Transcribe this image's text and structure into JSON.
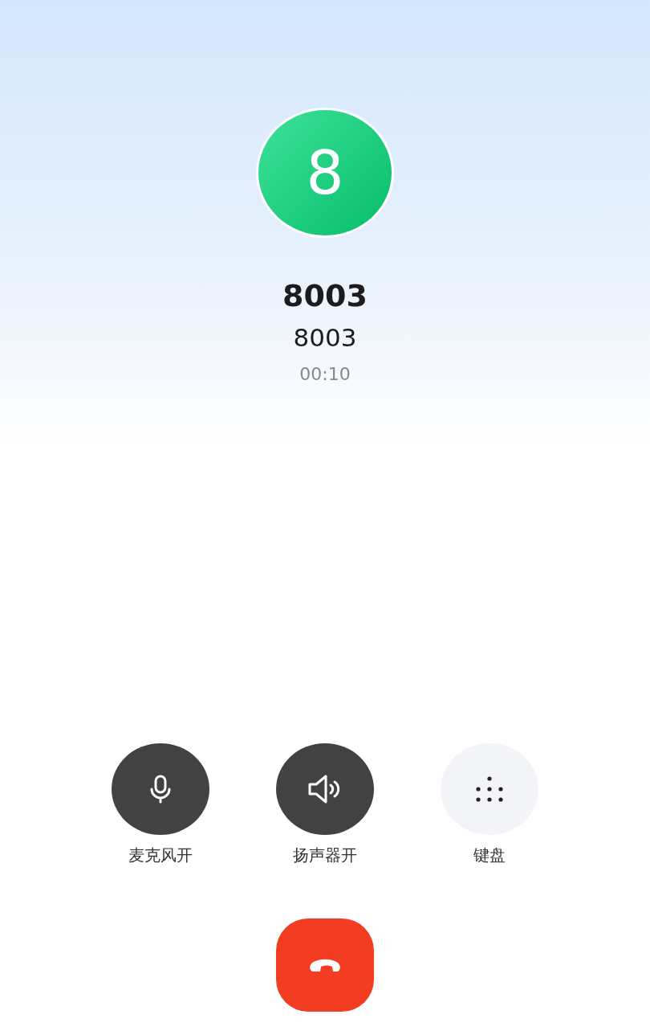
{
  "contact": {
    "avatar_letter": "8",
    "name": "8003",
    "number": "8003",
    "duration": "00:10"
  },
  "controls": [
    {
      "kind": "mic",
      "label": "麦克风开",
      "on": true
    },
    {
      "kind": "speaker",
      "label": "扬声器开",
      "on": true
    },
    {
      "kind": "keypad",
      "label": "键盘",
      "on": false
    }
  ],
  "end_call": {
    "kind": "hangup"
  }
}
